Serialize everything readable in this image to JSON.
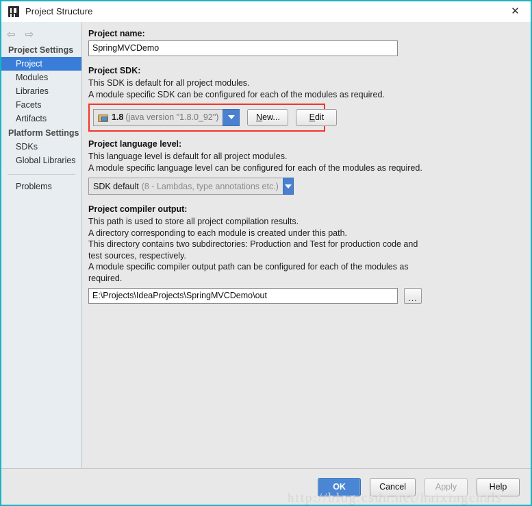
{
  "window": {
    "title": "Project Structure",
    "close_label": "✕",
    "app_icon": "intellij-idea-logo",
    "border_color": "#18b3c4"
  },
  "sidebar": {
    "nav": {
      "back": "⇦",
      "forward": "⇨"
    },
    "groups": [
      {
        "label": "Project Settings",
        "items": [
          {
            "label": "Project",
            "selected": true
          },
          {
            "label": "Modules",
            "selected": false
          },
          {
            "label": "Libraries",
            "selected": false
          },
          {
            "label": "Facets",
            "selected": false
          },
          {
            "label": "Artifacts",
            "selected": false
          }
        ]
      },
      {
        "label": "Platform Settings",
        "items": [
          {
            "label": "SDKs",
            "selected": false
          },
          {
            "label": "Global Libraries",
            "selected": false
          }
        ]
      }
    ],
    "extra_items": [
      {
        "label": "Problems",
        "selected": false
      }
    ],
    "selected_color": "#3a7dd8"
  },
  "main": {
    "project_name": {
      "label": "Project name:",
      "value": "SpringMVCDemo"
    },
    "project_sdk": {
      "label": "Project SDK:",
      "desc_line1": "This SDK is default for all project modules.",
      "desc_line2": "A module specific SDK can be configured for each of the modules as required.",
      "combo_version": "1.8",
      "combo_detail": "(java version \"1.8.0_92\")",
      "icon": "sdk-folder-icon",
      "new_button": "New...",
      "new_button_mnemonic": "N",
      "edit_button": "Edit",
      "edit_button_mnemonic": "E",
      "highlight_color": "#f4342a"
    },
    "language_level": {
      "label": "Project language level:",
      "desc_line1": "This language level is default for all project modules.",
      "desc_line2": "A module specific language level can be configured for each of the modules as required.",
      "combo_value": "SDK default",
      "combo_detail": "(8 - Lambdas, type annotations etc.)"
    },
    "compiler_output": {
      "label": "Project compiler output:",
      "desc_line1": "This path is used to store all project compilation results.",
      "desc_line2": "A directory corresponding to each module is created under this path.",
      "desc_line3": "This directory contains two subdirectories: Production and Test for production code and",
      "desc_line4": "test sources, respectively.",
      "desc_line5": "A module specific compiler output path can be configured for each of the modules as",
      "desc_line6": "required.",
      "value": "E:\\Projects\\IdeaProjects\\SpringMVCDemo\\out",
      "browse_label": "..."
    }
  },
  "footer": {
    "ok": "OK",
    "cancel": "Cancel",
    "apply": "Apply",
    "help": "Help",
    "apply_enabled": false,
    "primary_color": "#4a86d4"
  },
  "watermark": {
    "text": "http://blog.csdn.net/haixingchals"
  }
}
